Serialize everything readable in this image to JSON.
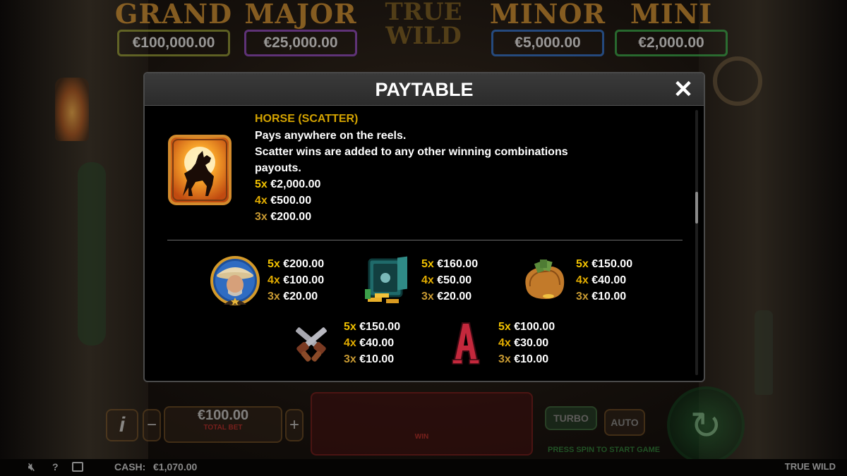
{
  "jackpots": [
    {
      "name": "GRAND",
      "value": "€100,000.00",
      "color": "#b07a2a",
      "border": "#7a7f2c"
    },
    {
      "name": "MAJOR",
      "value": "€25,000.00",
      "color": "#b07a2a",
      "border": "#7a3fa0"
    },
    {
      "name": "MINOR",
      "value": "€5,000.00",
      "color": "#b07a2a",
      "border": "#2a5fa8"
    },
    {
      "name": "MINI",
      "value": "€2,000.00",
      "color": "#b07a2a",
      "border": "#2f8a3c"
    }
  ],
  "logo": {
    "line1": "TRUE",
    "line2": "WILD"
  },
  "paytable": {
    "title": "PAYTABLE",
    "close_icon": "close-icon",
    "scatter": {
      "name": "HORSE (SCATTER)",
      "icon": "horse-scatter-icon",
      "lines": [
        "Pays anywhere on the reels.",
        "Scatter wins are added to any other winning combinations",
        "payouts."
      ],
      "pays": [
        {
          "mult": "5x",
          "value": "€2,000.00"
        },
        {
          "mult": "4x",
          "value": "€500.00"
        },
        {
          "mult": "3x",
          "value": "€200.00"
        }
      ]
    },
    "symbols": [
      {
        "icon": "sheriff-icon",
        "pays": [
          {
            "mult": "5x",
            "value": "€200.00"
          },
          {
            "mult": "4x",
            "value": "€100.00"
          },
          {
            "mult": "3x",
            "value": "€20.00"
          }
        ]
      },
      {
        "icon": "safe-icon",
        "pays": [
          {
            "mult": "5x",
            "value": "€160.00"
          },
          {
            "mult": "4x",
            "value": "€50.00"
          },
          {
            "mult": "3x",
            "value": "€20.00"
          }
        ]
      },
      {
        "icon": "money-bag-icon",
        "pays": [
          {
            "mult": "5x",
            "value": "€150.00"
          },
          {
            "mult": "4x",
            "value": "€40.00"
          },
          {
            "mult": "3x",
            "value": "€10.00"
          }
        ]
      },
      {
        "icon": "crossed-revolvers-icon",
        "pays": [
          {
            "mult": "5x",
            "value": "€150.00"
          },
          {
            "mult": "4x",
            "value": "€40.00"
          },
          {
            "mult": "3x",
            "value": "€10.00"
          }
        ]
      },
      {
        "icon": "letter-a-icon",
        "pays": [
          {
            "mult": "5x",
            "value": "€100.00"
          },
          {
            "mult": "4x",
            "value": "€30.00"
          },
          {
            "mult": "3x",
            "value": "€10.00"
          }
        ]
      }
    ],
    "scroll_position": 0.35
  },
  "controls": {
    "info_label": "i",
    "minus_label": "−",
    "plus_label": "+",
    "bet_value": "€100.00",
    "bet_label": "TOTAL BET",
    "win_label": "WIN",
    "turbo_label": "TURBO",
    "auto_label": "AUTO",
    "spin_hint": "PRESS SPIN TO START GAME",
    "spin_icon": "spin-arrows-icon"
  },
  "statusbar": {
    "sound_icon": "sound-muted-icon",
    "help_label": "?",
    "history_icon": "history-icon",
    "cash_label": "CASH:",
    "cash_value": "€1,070.00",
    "game_name": "TRUE WILD"
  }
}
